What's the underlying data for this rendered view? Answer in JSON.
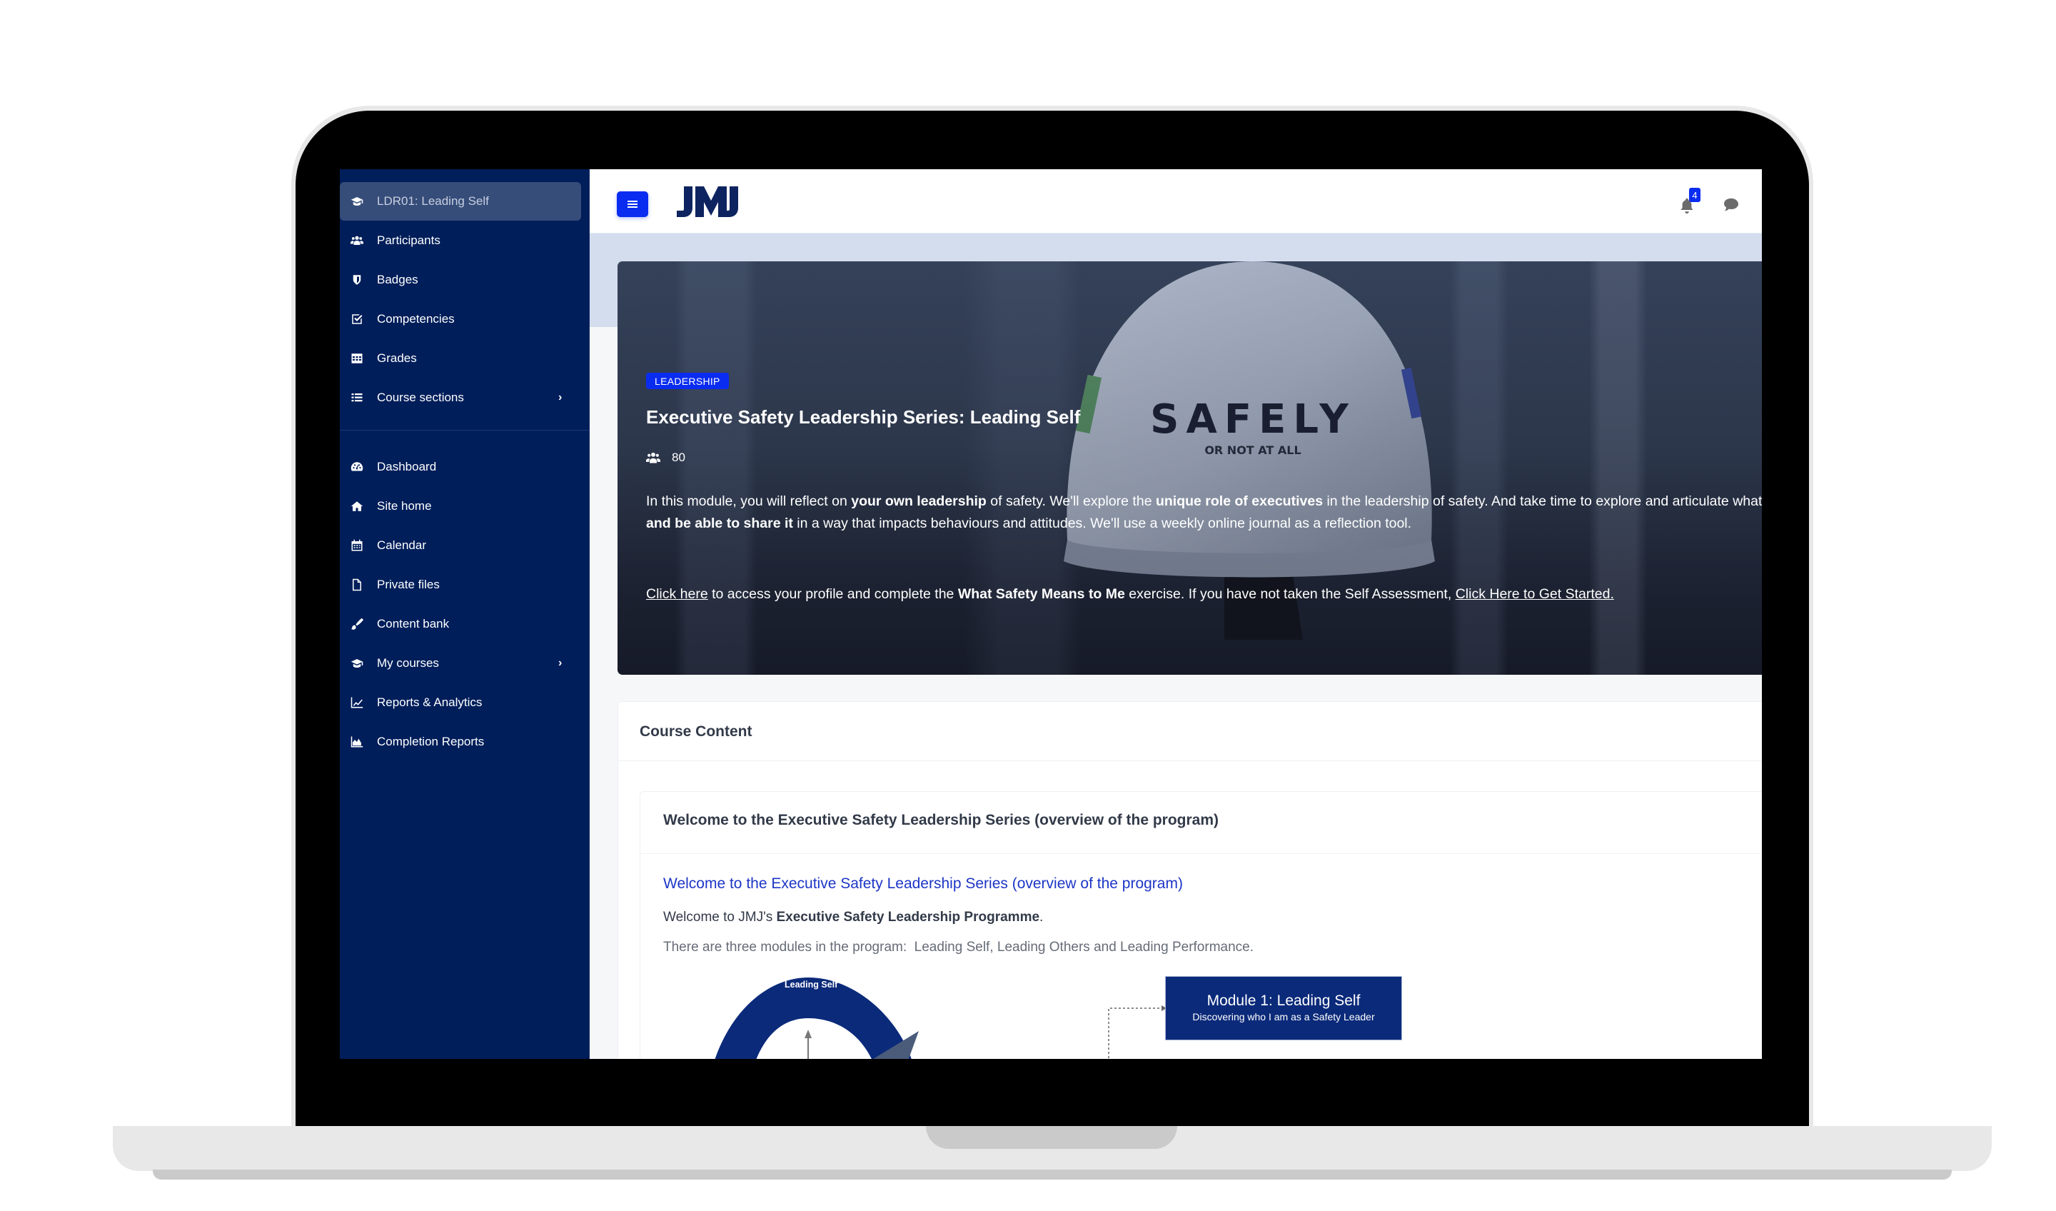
{
  "sidebar": {
    "items": [
      {
        "label": "LDR01: Leading Self",
        "icon": "graduation-cap-icon",
        "active": true
      },
      {
        "label": "Participants",
        "icon": "users-icon"
      },
      {
        "label": "Badges",
        "icon": "shield-icon"
      },
      {
        "label": "Competencies",
        "icon": "check-square-icon"
      },
      {
        "label": "Grades",
        "icon": "table-icon"
      },
      {
        "label": "Course sections",
        "icon": "list-icon",
        "has_submenu": true
      },
      {
        "label": "Dashboard",
        "icon": "tachometer-icon"
      },
      {
        "label": "Site home",
        "icon": "home-icon"
      },
      {
        "label": "Calendar",
        "icon": "calendar-icon"
      },
      {
        "label": "Private files",
        "icon": "file-icon"
      },
      {
        "label": "Content bank",
        "icon": "paint-brush-icon"
      },
      {
        "label": "My courses",
        "icon": "graduation-cap-icon",
        "has_submenu": true
      },
      {
        "label": "Reports & Analytics",
        "icon": "line-chart-icon"
      },
      {
        "label": "Completion Reports",
        "icon": "area-chart-icon"
      }
    ],
    "chevron": "›"
  },
  "header": {
    "logo_text": "JMJ",
    "notifications_count": "4",
    "brand_color": "#0a2cf0",
    "sidebar_color": "#001e5a"
  },
  "banner": {
    "category": "LEADERSHIP",
    "title": "Executive Safety Leadership Series: Leading Self",
    "participants_count": "80",
    "hat_text": "SAFELY",
    "hat_subtext": "OR NOT AT ALL",
    "desc": {
      "p1": "In this module, you will reflect on ",
      "b1": "your own leadership",
      "p2": " of safety. We'll explore the ",
      "b2": "unique role of executives",
      "p3": " in the leadership of safety. And take time to explore and articulate what safety means to you",
      "b3": "and be able to share it",
      "p4": " in a way that impacts behaviours and attitudes. We'll use a weekly online journal as a reflection tool."
    },
    "cta": {
      "link1": "Click here",
      "t1": " to access your profile and complete the ",
      "b1": "What Safety Means to Me",
      "t2": " exercise. If you have not taken the Self Assessment, ",
      "link2": "Click Here to Get Started."
    }
  },
  "course_content": {
    "title": "Course Content",
    "section": {
      "heading": "Welcome to the Executive Safety Leadership Series (overview of the program)",
      "link": "Welcome to the Executive Safety Leadership Series (overview of the program)",
      "welcome_prefix": "Welcome to JMJ's ",
      "welcome_bold": "Executive Safety Leadership Programme",
      "welcome_suffix": ".",
      "modules_text": "There are three modules in the program:  Leading Self, Leading Others and Leading Performance.",
      "diagram": {
        "arc_label": "Leading Self",
        "module_title": "Module 1: Leading Self",
        "module_subtitle": "Discovering who I am as a Safety Leader"
      }
    }
  }
}
